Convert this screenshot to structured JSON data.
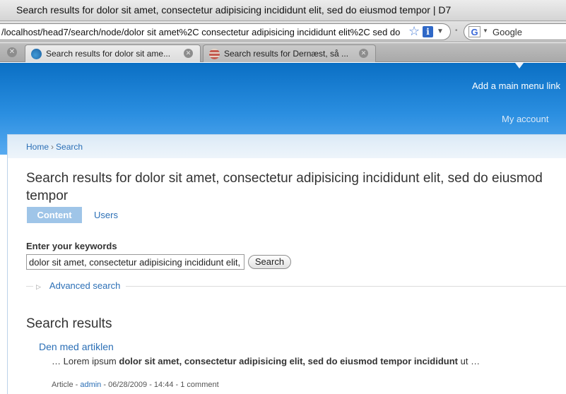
{
  "window": {
    "title": "Search results for dolor sit amet, consectetur adipisicing incididunt elit, sed do eiusmod tempor | D7"
  },
  "browser": {
    "url": "/localhost/head7/search/node/dolor sit amet%2C consectetur adipisicing incididunt elit%2C sed do",
    "search_engine_value": "Google",
    "tabs": [
      {
        "label": "Search results for dolor sit ame...",
        "active": true
      },
      {
        "label": "Search results for Dernæst, så ...",
        "active": false
      }
    ]
  },
  "site": {
    "main_menu_link": "Add a main menu link",
    "my_account": "My account"
  },
  "breadcrumb": {
    "home": "Home",
    "separator": "›",
    "current": "Search"
  },
  "page": {
    "title": "Search results for dolor sit amet, consectetur adipisicing incididunt elit, sed do eiusmod tempor",
    "tabs": [
      {
        "label": "Content",
        "active": true
      },
      {
        "label": "Users",
        "active": false
      }
    ]
  },
  "search_form": {
    "label": "Enter your keywords",
    "value": "dolor sit amet, consectetur adipisicing incididunt elit, sed do eiusmod tempor",
    "button": "Search",
    "advanced": "Advanced search"
  },
  "results": {
    "heading": "Search results",
    "items": [
      {
        "title": "Den med artiklen",
        "snippet_prefix": "… Lorem ipsum ",
        "snippet_bold": "dolor sit amet, consectetur adipisicing elit, sed do eiusmod tempor incididunt",
        "snippet_suffix": " ut …",
        "type": "Article",
        "sep1": " - ",
        "author": "admin",
        "sep2": " - ",
        "date": "06/28/2009 - 14:44",
        "sep3": " - ",
        "comments": "1 comment"
      }
    ]
  },
  "colors": {
    "link": "#2b6fb6",
    "header_top": "#0a6fc4",
    "header_bottom": "#57aaf0",
    "active_tab": "#9fc5e8"
  }
}
